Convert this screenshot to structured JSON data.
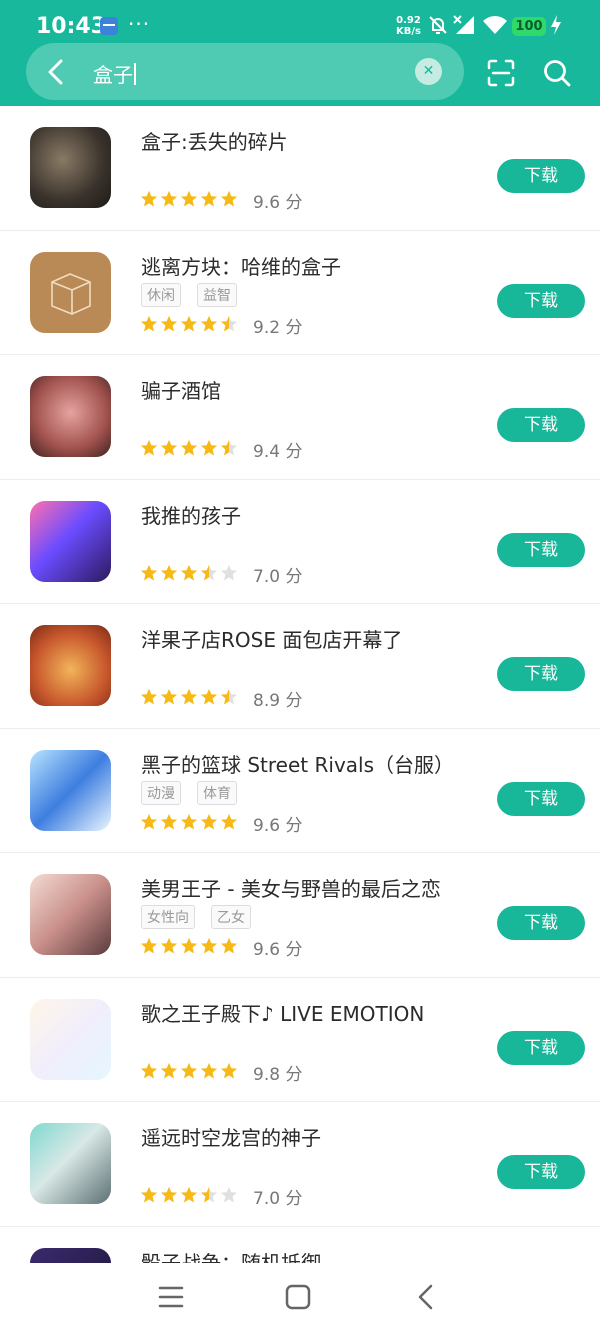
{
  "status_bar": {
    "time": "10:43",
    "more": "···",
    "net_speed_value": "0.92",
    "net_speed_unit": "KB/s",
    "battery": "100"
  },
  "search": {
    "query": "盒子"
  },
  "colors": {
    "brand": "#17b89b",
    "button": "#19b79a",
    "star_filled": "#f7b916",
    "star_empty": "#e0e0e0"
  },
  "apps": [
    {
      "name": "盒子:丢失的碎片",
      "tags": [],
      "stars": 5,
      "rating": "9.6 分",
      "button": "下载"
    },
    {
      "name": "逃离方块：哈维的盒子",
      "tags": [
        "休闲",
        "益智"
      ],
      "stars": 4.5,
      "rating": "9.2 分",
      "button": "下载"
    },
    {
      "name": "骗子酒馆",
      "tags": [],
      "stars": 4.5,
      "rating": "9.4 分",
      "button": "下载"
    },
    {
      "name": "我推的孩子",
      "tags": [],
      "stars": 3.5,
      "rating": "7.0 分",
      "button": "下载"
    },
    {
      "name": "洋果子店ROSE 面包店开幕了",
      "tags": [],
      "stars": 4.5,
      "rating": "8.9 分",
      "button": "下载"
    },
    {
      "name": "黑子的篮球 Street Rivals（台服）",
      "tags": [
        "动漫",
        "体育"
      ],
      "stars": 5,
      "rating": "9.6 分",
      "button": "下载"
    },
    {
      "name": "美男王子 - 美女与野兽的最后之恋",
      "tags": [
        "女性向",
        "乙女"
      ],
      "stars": 5,
      "rating": "9.6 分",
      "button": "下载"
    },
    {
      "name": "歌之王子殿下♪ LIVE EMOTION",
      "tags": [],
      "stars": 5,
      "rating": "9.8 分",
      "button": "下载"
    },
    {
      "name": "遥远时空龙宫的神子",
      "tags": [],
      "stars": 3.5,
      "rating": "7.0 分",
      "button": "下载"
    },
    {
      "name": "骰子战争：随机抵御",
      "tags": [],
      "stars": 0,
      "rating": "",
      "button": ""
    }
  ]
}
